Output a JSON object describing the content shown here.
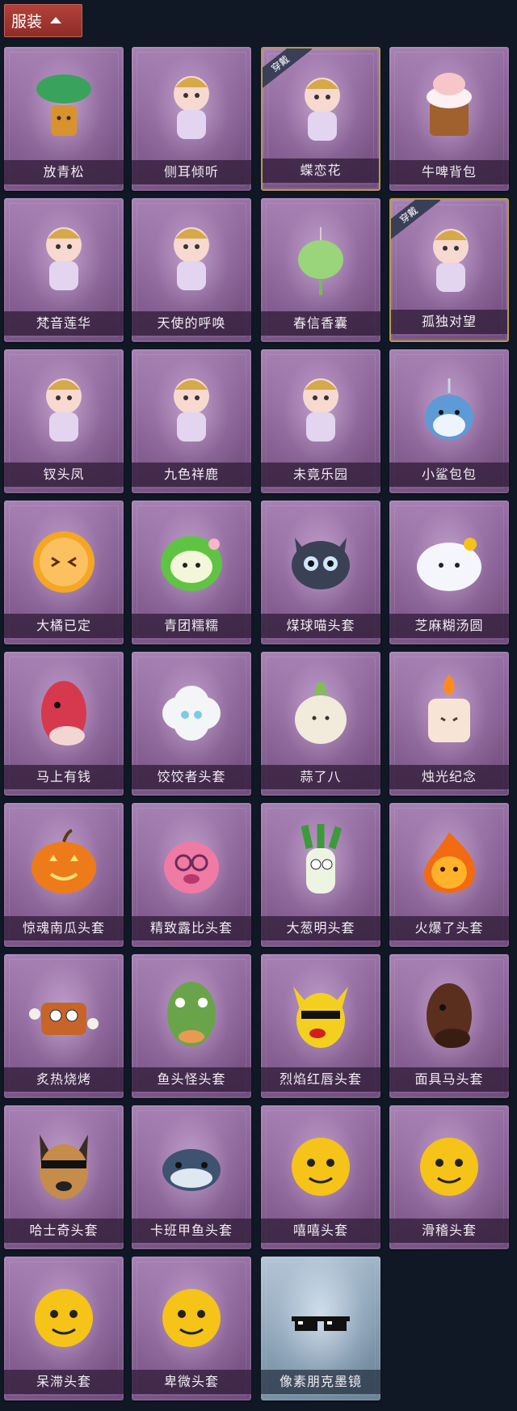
{
  "header": {
    "label": "服装"
  },
  "badge_text": "穿戴",
  "items": [
    {
      "label": "放青松",
      "icon": "bonsai-pine-pendant-icon",
      "equipped": false
    },
    {
      "label": "侧耳倾听",
      "icon": "lotus-wreath-pendant-icon",
      "equipped": false
    },
    {
      "label": "蝶恋花",
      "icon": "butterfly-bell-pendant-icon",
      "equipped": true
    },
    {
      "label": "牛啤背包",
      "icon": "cow-beer-mug-icon",
      "equipped": false
    },
    {
      "label": "梵音莲华",
      "icon": "lotus-figure-icon",
      "equipped": false
    },
    {
      "label": "天使的呼唤",
      "icon": "angel-figure-icon",
      "equipped": false
    },
    {
      "label": "春信香囊",
      "icon": "sachet-icon",
      "equipped": false
    },
    {
      "label": "孤独对望",
      "icon": "ice-figure-pendant-icon",
      "equipped": true
    },
    {
      "label": "钗头凤",
      "icon": "phoenix-crown-figure-icon",
      "equipped": false
    },
    {
      "label": "九色祥鹿",
      "icon": "deer-pendant-icon",
      "equipped": false
    },
    {
      "label": "未竟乐园",
      "icon": "paradise-girl-figure-icon",
      "equipped": false
    },
    {
      "label": "小鲨包包",
      "icon": "shark-bag-icon",
      "equipped": false
    },
    {
      "label": "大橘已定",
      "icon": "orange-face-icon",
      "equipped": false
    },
    {
      "label": "青团糯糯",
      "icon": "green-rice-ball-icon",
      "equipped": false
    },
    {
      "label": "煤球喵头套",
      "icon": "black-cat-head-icon",
      "equipped": false
    },
    {
      "label": "芝麻糊汤圆",
      "icon": "rice-dumpling-icon",
      "equipped": false
    },
    {
      "label": "马上有钱",
      "icon": "red-horse-head-icon",
      "equipped": false
    },
    {
      "label": "饺饺者头套",
      "icon": "cloud-dumpling-head-icon",
      "equipped": false
    },
    {
      "label": "蒜了八",
      "icon": "garlic-head-icon",
      "equipped": false
    },
    {
      "label": "烛光纪念",
      "icon": "candle-head-icon",
      "equipped": false
    },
    {
      "label": "惊魂南瓜头套",
      "icon": "pumpkin-head-icon",
      "equipped": false
    },
    {
      "label": "精致露比头套",
      "icon": "pink-beaver-head-icon",
      "equipped": false
    },
    {
      "label": "大葱明头套",
      "icon": "scallion-head-icon",
      "equipped": false
    },
    {
      "label": "火爆了头套",
      "icon": "fire-head-icon",
      "equipped": false
    },
    {
      "label": "炙热烧烤",
      "icon": "meat-bone-head-icon",
      "equipped": false
    },
    {
      "label": "鱼头怪头套",
      "icon": "fish-head-icon",
      "equipped": false
    },
    {
      "label": "烈焰红唇头套",
      "icon": "yellow-mouse-head-icon",
      "equipped": false
    },
    {
      "label": "面具马头套",
      "icon": "horse-mask-icon",
      "equipped": false
    },
    {
      "label": "哈士奇头套",
      "icon": "husky-head-icon",
      "equipped": false
    },
    {
      "label": "卡班甲鱼头套",
      "icon": "seal-head-icon",
      "equipped": false
    },
    {
      "label": "嘻嘻头套",
      "icon": "grin-emoji-head-icon",
      "equipped": false
    },
    {
      "label": "滑稽头套",
      "icon": "funny-emoji-head-icon",
      "equipped": false
    },
    {
      "label": "呆滞头套",
      "icon": "stunned-emoji-head-icon",
      "equipped": false
    },
    {
      "label": "卑微头套",
      "icon": "humble-emoji-head-icon",
      "equipped": false
    },
    {
      "label": "像素朋克墨镜",
      "icon": "pixel-sunglasses-icon",
      "equipped": false,
      "special": true
    }
  ]
}
